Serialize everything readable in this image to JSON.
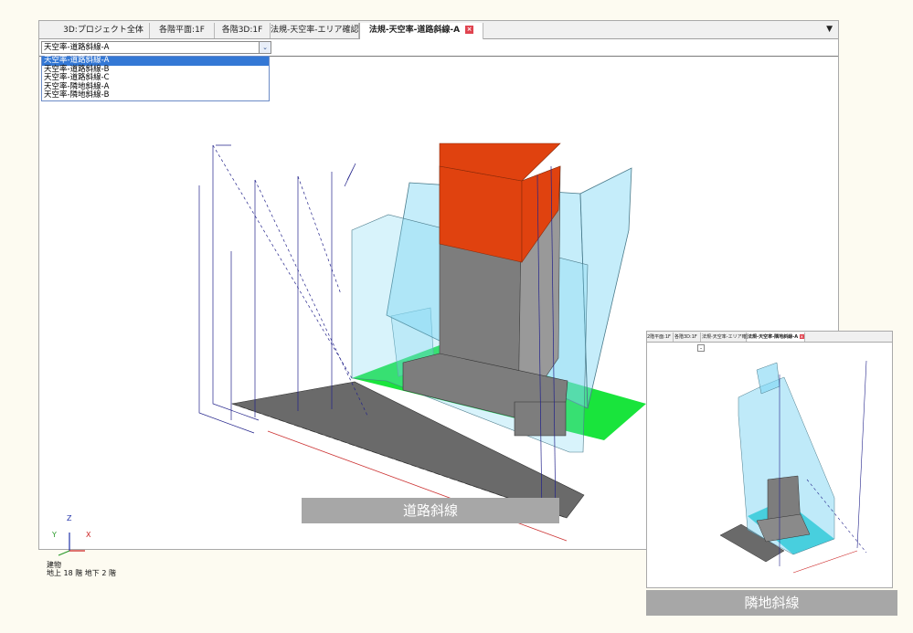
{
  "tabs": [
    {
      "label": "3D:プロジェクト全体"
    },
    {
      "label": "各階平面:1F"
    },
    {
      "label": "各階3D:1F"
    },
    {
      "label": "法規-天空率-エリア確認"
    },
    {
      "label": "法規-天空率-道路斜線-A",
      "active": true
    }
  ],
  "tab_close_glyph": "×",
  "tab_menu_glyph": "▼",
  "combo": {
    "value": "天空率-道路斜線-A",
    "button_glyph": "⌄"
  },
  "dropdown": {
    "options": [
      "天空率-道路斜線-A",
      "天空率-道路斜線-B",
      "天空率-道路斜線-C",
      "天空率-隣地斜線-A",
      "天空率-隣地斜線-B"
    ],
    "selected_index": 0
  },
  "axis": {
    "z": "Z",
    "y": "Y",
    "x": "X"
  },
  "status": {
    "line1": "建物",
    "line2": "地上 18 階  地下 2 階"
  },
  "captions": {
    "main": "道路斜線",
    "inset": "隣地斜線"
  },
  "inset": {
    "tabs": [
      "2階平面:1F",
      "各階3D:1F",
      "法規-天空率-エリア確認",
      "法規-天空率-隣地斜線-A"
    ],
    "close_glyph": "×"
  },
  "colors": {
    "selection": "#3478d5",
    "envelope": "#7fd6f3",
    "roof_red": "#e0420f",
    "green_zone": "#19e43c",
    "building_gray": "#7d7d7d",
    "ground": "#6a6a6a",
    "cyan_zone": "#11c9c9",
    "caption_bg": "#a7a7a7"
  }
}
